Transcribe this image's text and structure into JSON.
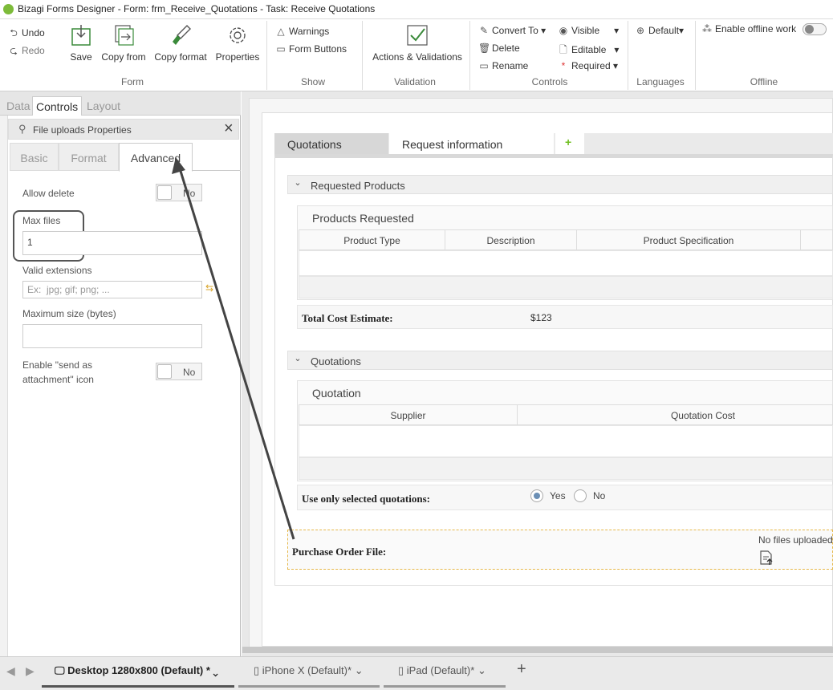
{
  "window": {
    "title": "Bizagi Forms Designer  - Form: frm_Receive_Quotations - Task:  Receive Quotations"
  },
  "ribbon": {
    "undo": "Undo",
    "redo": "Redo",
    "save": "Save",
    "copy_from": "Copy from",
    "copy_format": "Copy format",
    "properties": "Properties",
    "group_form": "Form",
    "warnings": "Warnings",
    "form_buttons": "Form Buttons",
    "group_show": "Show",
    "actions_validations": "Actions & Validations",
    "group_validation": "Validation",
    "convert_to": "Convert To",
    "delete": "Delete",
    "rename": "Rename",
    "visible": "Visible",
    "editable": "Editable",
    "required": "Required",
    "group_controls": "Controls",
    "language_default": "Default",
    "group_languages": "Languages",
    "enable_offline": "Enable offline work",
    "group_offline": "Offline"
  },
  "left_tabs": [
    "Data",
    "Controls",
    "Layout"
  ],
  "props": {
    "header": "File uploads Properties",
    "tabs": [
      "Basic",
      "Format",
      "Advanced"
    ],
    "allow_delete_label": "Allow delete",
    "allow_delete_value": "No",
    "max_files_label": "Max files",
    "max_files_value": "1",
    "valid_ext_label": "Valid extensions",
    "valid_ext_placeholder": "Ex:  jpg; gif; png; ...",
    "max_size_label": "Maximum size (bytes)",
    "max_size_value": "",
    "send_attach_label_1": "Enable \"send as",
    "send_attach_label_2": "attachment\" icon",
    "send_attach_value": "No"
  },
  "form": {
    "tabs": [
      "Quotations",
      "Request information",
      "+"
    ],
    "requested_products": "Requested Products",
    "products_requested": "Products Requested",
    "products_cols": [
      "Product Type",
      "Description",
      "Product Specification"
    ],
    "total_cost_label": "Total Cost Estimate:",
    "total_cost_value": "$123",
    "quotations_section": "Quotations",
    "quotation_grid": "Quotation",
    "quotation_cols": [
      "Supplier",
      "Quotation Cost"
    ],
    "use_selected_label": "Use only selected quotations:",
    "yes": "Yes",
    "no": "No",
    "purchase_order_label": "Purchase Order File:",
    "no_files": "No files uploaded"
  },
  "devices": [
    {
      "label": "Desktop 1280x800 (Default)",
      "mark": "*"
    },
    {
      "label": "iPhone X (Default)",
      "mark": "*"
    },
    {
      "label": "iPad (Default)",
      "mark": "*"
    }
  ]
}
